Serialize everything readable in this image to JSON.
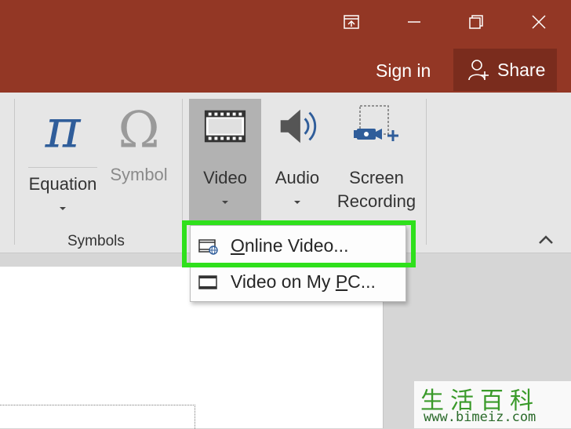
{
  "titlebar": {
    "color": "#933725",
    "sign_in": "Sign in",
    "share": "Share"
  },
  "ribbon": {
    "groups": [
      {
        "label": "Symbols",
        "buttons": [
          {
            "label": "Equation",
            "icon": "pi-icon"
          },
          {
            "label": "Symbol",
            "icon": "omega-icon"
          }
        ]
      },
      {
        "label": "",
        "buttons": [
          {
            "label": "Video",
            "icon": "film-icon"
          },
          {
            "label": "Audio",
            "icon": "speaker-icon"
          },
          {
            "label_line1": "Screen",
            "label_line2": "Recording",
            "icon": "screen-recording-icon"
          }
        ]
      }
    ]
  },
  "video_menu": {
    "online_video_first": "O",
    "online_video_rest": "nline Video...",
    "pc_video_prefix": "Video on My ",
    "pc_video_underlined": "P",
    "pc_video_suffix": "C..."
  },
  "highlight_color": "#2fe01c",
  "watermark": {
    "chars": "生活百科",
    "url": "www.bimeiz.com"
  }
}
